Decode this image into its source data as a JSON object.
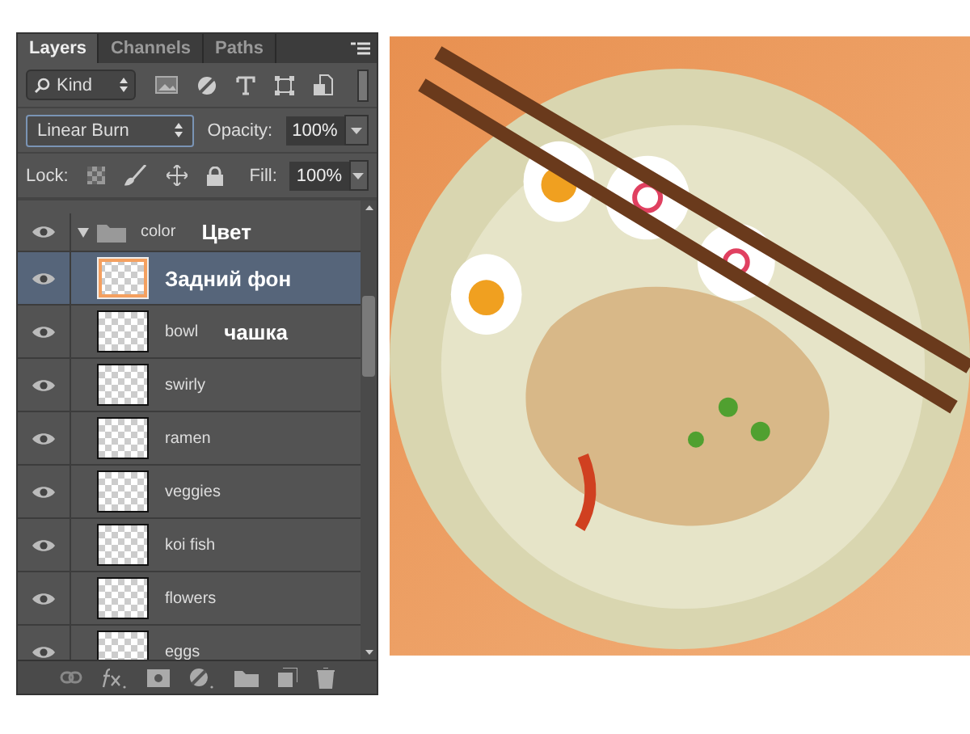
{
  "tabs": [
    {
      "label": "Layers",
      "selected": true
    },
    {
      "label": "Channels",
      "selected": false
    },
    {
      "label": "Paths",
      "selected": false
    }
  ],
  "filter": {
    "label": "Kind"
  },
  "blend_mode": "Linear Burn",
  "opacity": {
    "label": "Opacity:",
    "value": "100%"
  },
  "lock": {
    "label": "Lock:"
  },
  "fill": {
    "label": "Fill:",
    "value": "100%"
  },
  "layers": [
    {
      "kind": "group",
      "name": "color",
      "annotation": "Цвет",
      "visible": true,
      "expanded": true,
      "selected": false,
      "children": [
        {
          "kind": "layer",
          "name": "Задний фон",
          "visible": true,
          "selected": true
        },
        {
          "kind": "layer",
          "name": "bowl",
          "annotation": "чашка",
          "visible": true,
          "selected": false
        },
        {
          "kind": "layer",
          "name": "swirly",
          "visible": true,
          "selected": false
        },
        {
          "kind": "layer",
          "name": "ramen",
          "visible": true,
          "selected": false
        },
        {
          "kind": "layer",
          "name": "veggies",
          "visible": true,
          "selected": false
        },
        {
          "kind": "layer",
          "name": "koi fish",
          "visible": true,
          "selected": false
        },
        {
          "kind": "layer",
          "name": "flowers",
          "visible": true,
          "selected": false
        },
        {
          "kind": "layer",
          "name": "eggs",
          "visible": true,
          "selected": false
        }
      ]
    }
  ]
}
